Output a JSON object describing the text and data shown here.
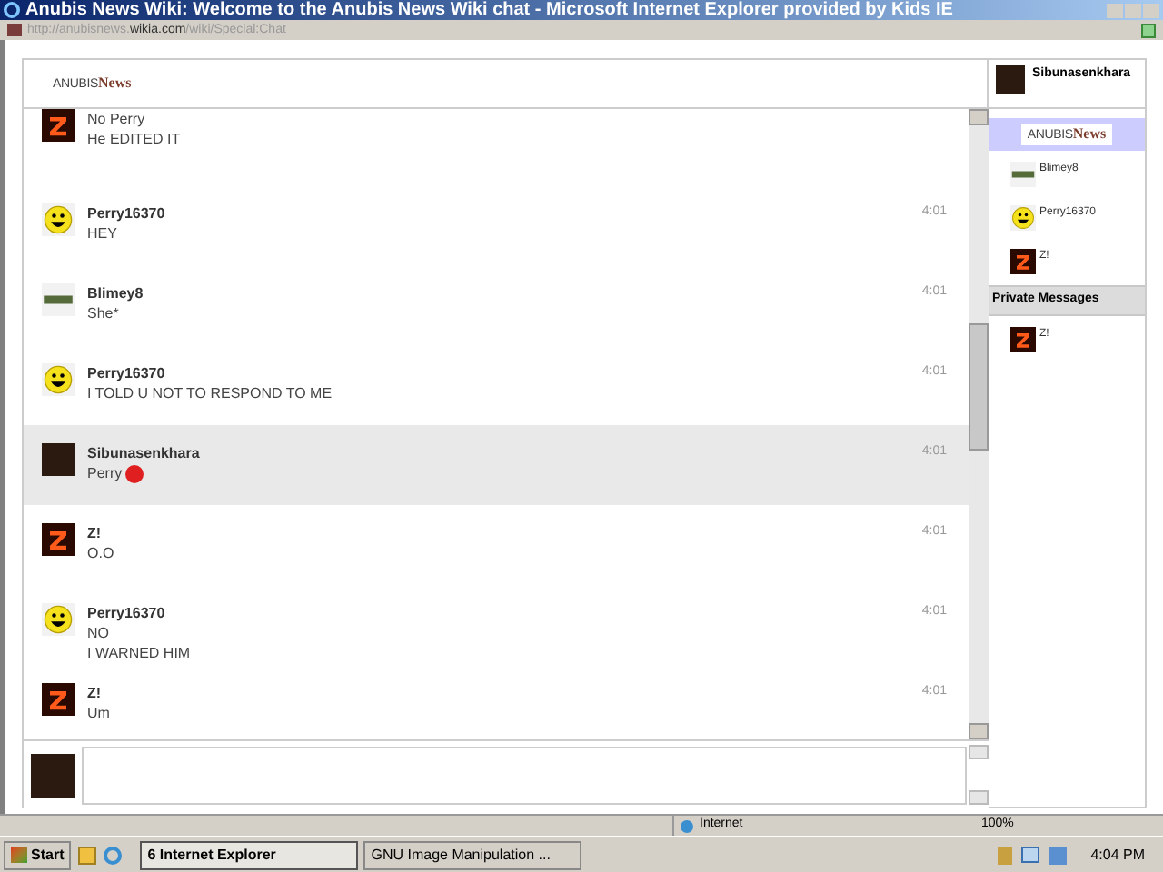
{
  "window": {
    "title": "Anubis News Wiki: Welcome to the Anubis News Wiki chat - Microsoft Internet Explorer provided by Kids IE"
  },
  "address": {
    "url_parts": [
      {
        "text": "http://anubisnews.",
        "kind": "dim"
      },
      {
        "text": "wikia.com",
        "kind": "strong"
      },
      {
        "text": "/wiki/Special:Chat",
        "kind": "dim"
      }
    ]
  },
  "header": {
    "logo": {
      "first": "ANUBIS",
      "second": "News"
    },
    "user": {
      "name": "Sibunasenkhara",
      "avatar": {
        "kind": "photo"
      }
    }
  },
  "messages": [
    {
      "avatar": {
        "kind": "z"
      },
      "lines": [
        "No Perry",
        "He EDITED IT"
      ],
      "highlighted": false
    },
    {
      "author": "Perry16370",
      "avatar": {
        "kind": "smiley"
      },
      "lines": [
        "HEY"
      ],
      "time": "4:01",
      "highlighted": false
    },
    {
      "author": "Blimey8",
      "avatar": {
        "kind": "landscape"
      },
      "lines": [
        "She*"
      ],
      "time": "4:01",
      "highlighted": false
    },
    {
      "author": "Perry16370",
      "avatar": {
        "kind": "smiley"
      },
      "lines": [
        "I TOLD U NOT TO RESPOND TO ME"
      ],
      "time": "4:01",
      "highlighted": false
    },
    {
      "author": "Sibunasenkhara",
      "avatar": {
        "kind": "photo"
      },
      "lines": [
        "Perry"
      ],
      "stop_emoticon": true,
      "time": "4:01",
      "highlighted": true
    },
    {
      "author": "Z!",
      "avatar": {
        "kind": "z"
      },
      "lines": [
        "O.O"
      ],
      "time": "4:01",
      "highlighted": false
    },
    {
      "author": "Perry16370",
      "avatar": {
        "kind": "smiley"
      },
      "lines": [
        "NO",
        "I WARNED HIM"
      ],
      "time": "4:01",
      "highlighted": false
    },
    {
      "author": "Z!",
      "avatar": {
        "kind": "z"
      },
      "lines": [
        "Um"
      ],
      "time": "4:01",
      "highlighted": false
    }
  ],
  "sidebar": {
    "room": {
      "first": "ANUBIS",
      "second": "News",
      "selected": true
    },
    "users": [
      {
        "name": "Blimey8",
        "avatar": {
          "kind": "landscape"
        }
      },
      {
        "name": "Perry16370",
        "avatar": {
          "kind": "smiley"
        }
      },
      {
        "name": "Z!",
        "avatar": {
          "kind": "z"
        }
      }
    ],
    "private_heading": "Private Messages",
    "private": [
      {
        "name": "Z!",
        "avatar": {
          "kind": "z"
        }
      }
    ]
  },
  "composer": {
    "avatar": {
      "kind": "photo"
    }
  },
  "status_bar": {
    "zone": "Internet",
    "zoom": "100%"
  },
  "taskbar": {
    "start": "Start",
    "tasks": [
      {
        "label": "6 Internet Explorer",
        "selected": true
      },
      {
        "label": "GNU Image Manipulation ...",
        "selected": false
      }
    ],
    "clock": "4:04 PM"
  }
}
